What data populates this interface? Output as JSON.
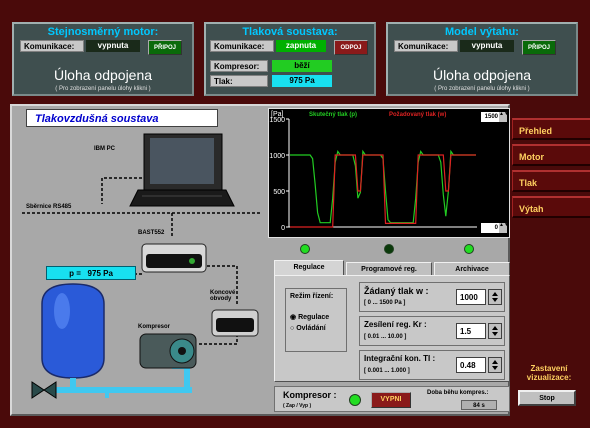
{
  "panels": {
    "motor": {
      "title": "Stejnosměrný motor:",
      "comm_label": "Komunikace:",
      "comm_value": "vypnuta",
      "button": "PŘIPOJ",
      "status": "Úloha odpojena",
      "hint": "( Pro zobrazení panelu úlohy klikni )"
    },
    "pressure": {
      "title": "Tlaková soustava:",
      "comm_label": "Komunikace:",
      "comm_value": "zapnuta",
      "button": "ODPOJ",
      "compressor_label": "Kompresor:",
      "compressor_value": "běží",
      "pressure_label": "Tlak:",
      "pressure_value": "975 Pa"
    },
    "elevator": {
      "title": "Model výtahu:",
      "comm_label": "Komunikace:",
      "comm_value": "vypnuta",
      "button": "PŘIPOJ",
      "status": "Úloha odpojena",
      "hint": "( Pro zobrazení panelu úlohy klikni )"
    }
  },
  "main": {
    "title": "Tlakovzdušná soustava",
    "labels": {
      "ibm_pc": "IBM PC",
      "bus": "Sběrnice RS485",
      "bast": "BAST552",
      "endstops": "Koncové\nobvody",
      "compressor": "Kompresor"
    },
    "tank_pressure": "p =   975 Pa"
  },
  "chart_data": {
    "type": "line",
    "ylabel": "[Pa]",
    "legend": [
      "Skutečný tlak (p)",
      "Požadovaný tlak (w)"
    ],
    "ylim": [
      0,
      1500
    ],
    "yticks": [
      0,
      500,
      1000,
      1500
    ],
    "ymax_value": "1500",
    "ymin_value": "0",
    "series": [
      {
        "name": "Skutečný tlak (p)",
        "color": "#22cc22",
        "values": [
          1000,
          1000,
          1000,
          1000,
          1000,
          1000,
          1000,
          1000,
          1000,
          950,
          600,
          200,
          60,
          60,
          60,
          60,
          60,
          400,
          900,
          1050,
          1000,
          1000,
          1000,
          1000,
          1000,
          1000,
          850,
          400,
          480,
          1050,
          1000,
          1000,
          1000,
          1000,
          1000,
          1000,
          1000,
          950,
          500,
          100,
          60,
          60,
          60,
          60,
          60,
          60,
          60,
          60,
          60,
          60,
          400,
          900,
          1050,
          1000,
          1000,
          1000,
          1000,
          1000,
          1000,
          1000,
          900,
          450,
          150,
          500,
          1050,
          1000,
          1000,
          1000,
          1000,
          1000,
          1000,
          1000,
          1000,
          1000,
          1000
        ]
      },
      {
        "name": "Požadovaný tlak (w)",
        "color": "#dd2222",
        "values": [
          0,
          0,
          0,
          0,
          0,
          0,
          0,
          0,
          0,
          0,
          0,
          0,
          0,
          0,
          0,
          0,
          0,
          0,
          1000,
          1000,
          1000,
          1000,
          1000,
          1000,
          1000,
          1000,
          1000,
          500,
          500,
          1000,
          1000,
          1000,
          1000,
          1000,
          1000,
          1000,
          1000,
          1000,
          50,
          50,
          50,
          50,
          50,
          50,
          50,
          50,
          50,
          50,
          50,
          50,
          50,
          1000,
          1000,
          1000,
          1000,
          1000,
          1000,
          1000,
          1000,
          1000,
          1000,
          1000,
          500,
          500,
          1000,
          1000,
          1000,
          1000,
          1000,
          1000,
          1000,
          1000,
          1000,
          1000,
          1000
        ]
      }
    ]
  },
  "leds": [
    {
      "color": "#22dd22"
    },
    {
      "color": "#0a3a0a"
    },
    {
      "color": "#22dd22"
    }
  ],
  "tabs": [
    "Regulace",
    "Programové reg.",
    "Archivace"
  ],
  "control": {
    "mode_title": "Režim řízení:",
    "mode_options": [
      "Regulace",
      "Ovládání"
    ],
    "setpoint_label": "Žádaný tlak  w :",
    "setpoint_range": "[ 0 ... 1500 Pa ]",
    "setpoint_value": "1000",
    "gain_label": "Zesílení reg. Kr :",
    "gain_range": "[ 0.01 ... 10.00 ]",
    "gain_value": "1.5",
    "integral_label": "Integrační kon. TI :",
    "integral_range": "[ 0.001 ... 1.000 ]",
    "integral_value": "0.48"
  },
  "compressor_bar": {
    "label": "Kompresor :",
    "sublabel": "( Zap / Vyp )",
    "button": "VYPNI",
    "runtime_label": "Doba běhu kompres.:",
    "runtime_value": "84 s"
  },
  "nav": [
    "Přehled",
    "Motor",
    "Tlak",
    "Výtah"
  ],
  "stop": {
    "label": "Zastavení vizualizace:",
    "button": "Stop"
  }
}
